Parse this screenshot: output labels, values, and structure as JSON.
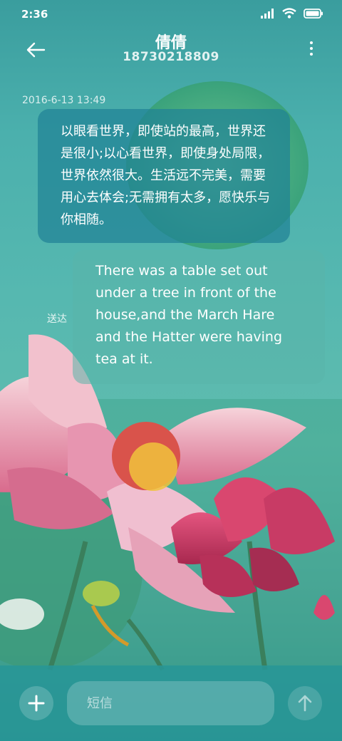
{
  "status_bar": {
    "time": "2:36",
    "icons": [
      "signal-icon",
      "wifi-icon",
      "battery-icon"
    ]
  },
  "header": {
    "contact_name": "倩倩",
    "phone_number": "18730218809"
  },
  "conversation": {
    "timestamp": "2016-6-13 13:49",
    "messages": [
      {
        "direction": "incoming",
        "text": "以眼看世界，即使站的最高，世界还是很小;以心看世界，即使身处局限，世界依然很大。生活远不完美，需要用心去体会;无需拥有太多，愿快乐与你相随。"
      },
      {
        "direction": "outgoing",
        "status": "送达",
        "text": "There was a table set out under a tree in front of the house,and the March Hare and the Hatter were having tea at it."
      }
    ]
  },
  "composer": {
    "placeholder": "短信",
    "icons": [
      "plus-icon",
      "send-arrow-icon"
    ]
  }
}
